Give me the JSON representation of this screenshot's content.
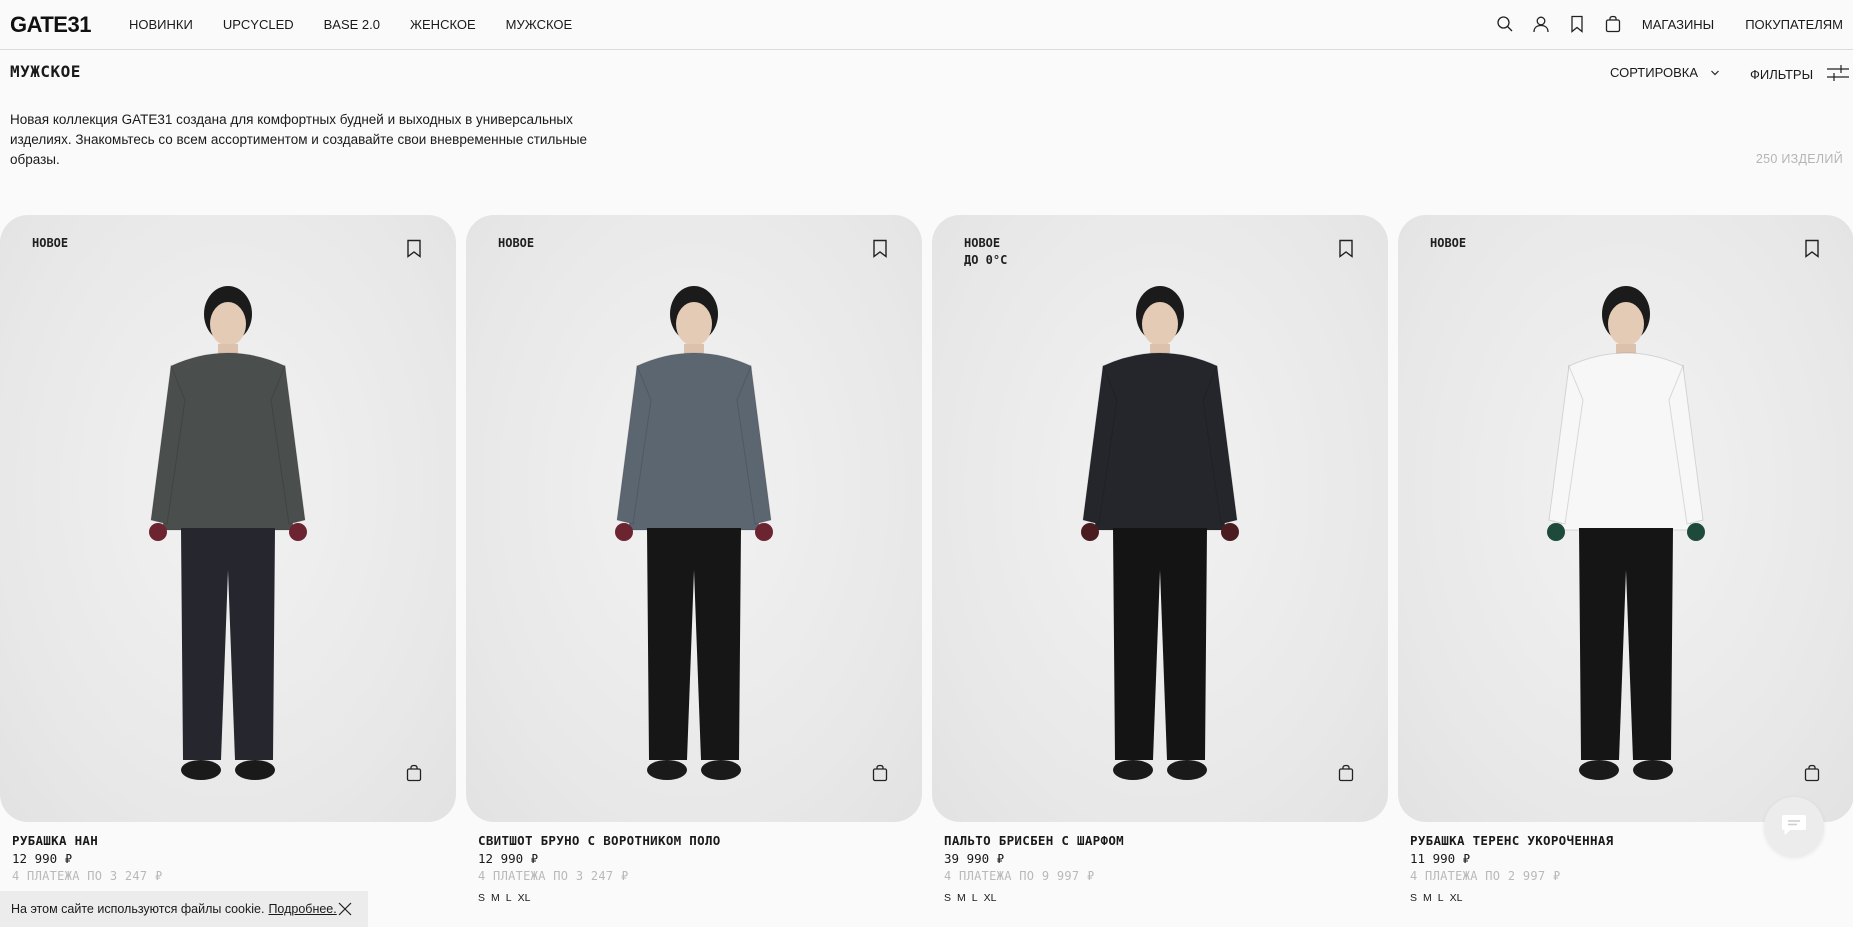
{
  "header": {
    "logo": "GATE31",
    "nav": [
      "НОВИНКИ",
      "UPCYCLED",
      "BASE 2.0",
      "ЖЕНСКОЕ",
      "МУЖСКОЕ"
    ],
    "icons": [
      "search-icon",
      "user-icon",
      "bookmark-icon",
      "bag-icon"
    ],
    "right_links": [
      "МАГАЗИНЫ",
      "ПОКУПАТЕЛЯМ"
    ]
  },
  "page": {
    "title": "МУЖСКОЕ",
    "sort_label": "СОРТИРОВКА",
    "filters_label": "ФИЛЬТРЫ",
    "description": "Новая коллекция GATE31 создана для комфортных будней и выходных в универсальных изделиях. Знакомьтесь со всем ассортиментом и создавайте свои вневременные стильные образы.",
    "count": "250 ИЗДЕЛИЙ"
  },
  "products": [
    {
      "badge": "НОВОЕ",
      "name": "РУБАШКА НАН",
      "price": "12 990 ₽",
      "installments": "4 ПЛАТЕЖА ПО 3 247 ₽",
      "sizes": [],
      "top_color": "#4a4e4d",
      "bottom_color": "#25262e",
      "accent": "#6b2430"
    },
    {
      "badge": "НОВОЕ",
      "name": "СВИТШОТ БРУНО С ВОРОТНИКОМ ПОЛО",
      "price": "12 990 ₽",
      "installments": "4 ПЛАТЕЖА ПО 3 247 ₽",
      "sizes": [
        "S",
        "M",
        "L",
        "XL"
      ],
      "top_color": "#5c6670",
      "bottom_color": "#161616",
      "accent": "#6b2430"
    },
    {
      "badge": "НОВОЕ\nДО 0°C",
      "name": "ПАЛЬТО БРИСБЕН С ШАРФОМ",
      "price": "39 990 ₽",
      "installments": "4 ПЛАТЕЖА ПО 9 997 ₽",
      "sizes": [
        "S",
        "M",
        "L",
        "XL"
      ],
      "top_color": "#24262c",
      "bottom_color": "#141414",
      "accent": "#4a1c20"
    },
    {
      "badge": "НОВОЕ",
      "name": "РУБАШКА ТЕРЕНС УКОРОЧЕННАЯ",
      "price": "11 990 ₽",
      "installments": "4 ПЛАТЕЖА ПО 2 997 ₽",
      "sizes": [
        "S",
        "M",
        "L",
        "XL"
      ],
      "top_color": "#f7f7f7",
      "bottom_color": "#151515",
      "accent": "#1e4a3c"
    }
  ],
  "cookie": {
    "text": "На этом сайте используются файлы cookie.",
    "more": "Подробнее."
  },
  "chat": {
    "icon": "chat-icon"
  }
}
